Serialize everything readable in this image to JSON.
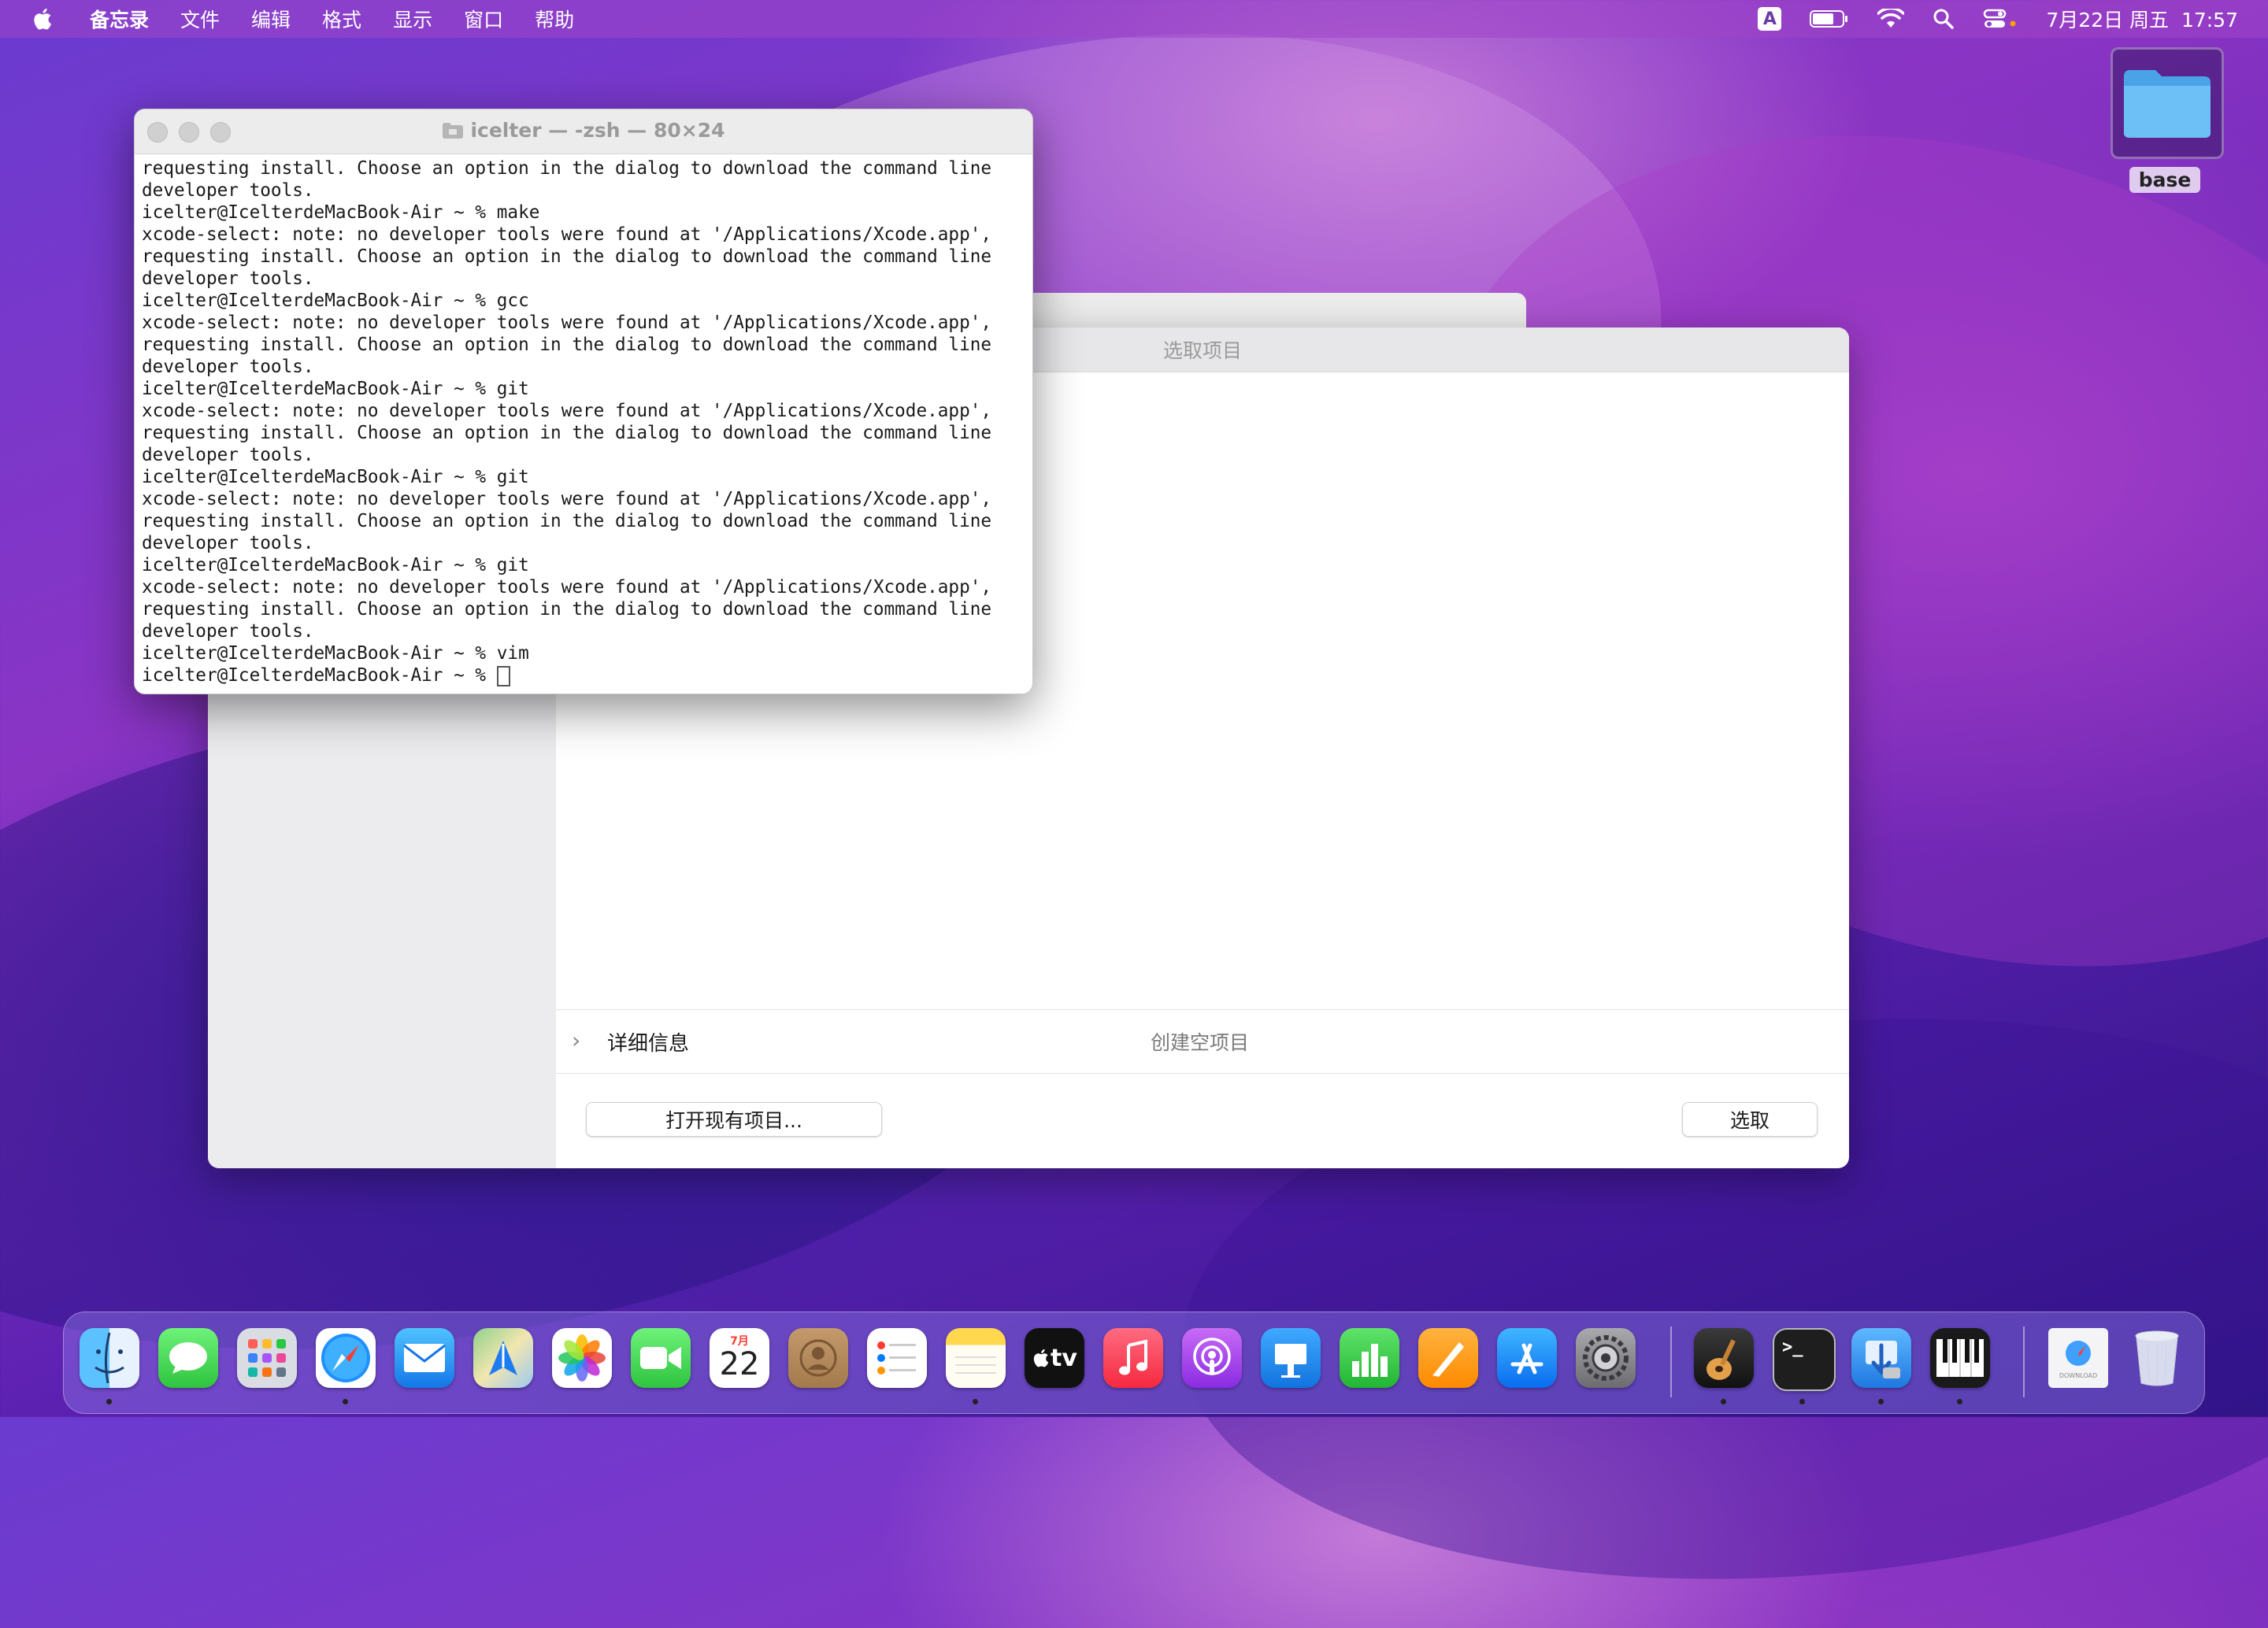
{
  "menubar": {
    "app_name": "备忘录",
    "menus": [
      "文件",
      "编辑",
      "格式",
      "显示",
      "窗口",
      "帮助"
    ],
    "input_method": "A",
    "datetime": "7月22日 周五  17:57"
  },
  "desktop": {
    "folder_label": "base"
  },
  "terminal": {
    "title": "icelter — -zsh — 80×24",
    "output": "requesting install. Choose an option in the dialog to download the command line\ndeveloper tools.\nicelter@IcelterdeMacBook-Air ~ % make\nxcode-select: note: no developer tools were found at '/Applications/Xcode.app',\nrequesting install. Choose an option in the dialog to download the command line\ndeveloper tools.\nicelter@IcelterdeMacBook-Air ~ % gcc\nxcode-select: note: no developer tools were found at '/Applications/Xcode.app',\nrequesting install. Choose an option in the dialog to download the command line\ndeveloper tools.\nicelter@IcelterdeMacBook-Air ~ % git\nxcode-select: note: no developer tools were found at '/Applications/Xcode.app',\nrequesting install. Choose an option in the dialog to download the command line\ndeveloper tools.\nicelter@IcelterdeMacBook-Air ~ % git\nxcode-select: note: no developer tools were found at '/Applications/Xcode.app',\nrequesting install. Choose an option in the dialog to download the command line\ndeveloper tools.\nicelter@IcelterdeMacBook-Air ~ % git\nxcode-select: note: no developer tools were found at '/Applications/Xcode.app',\nrequesting install. Choose an option in the dialog to download the command line\ndeveloper tools.\nicelter@IcelterdeMacBook-Air ~ % vim\n",
    "prompt": "icelter@IcelterdeMacBook-Air ~ % "
  },
  "chooser": {
    "title": "选取项目",
    "detail_label": "详细信息",
    "empty_project": "创建空项目",
    "open_button": "打开现有项目...",
    "choose_button": "选取"
  },
  "dock": {
    "calendar_month": "7月",
    "calendar_day": "22",
    "tv_label": "tv",
    "download_label": "DOWNLOAD"
  }
}
